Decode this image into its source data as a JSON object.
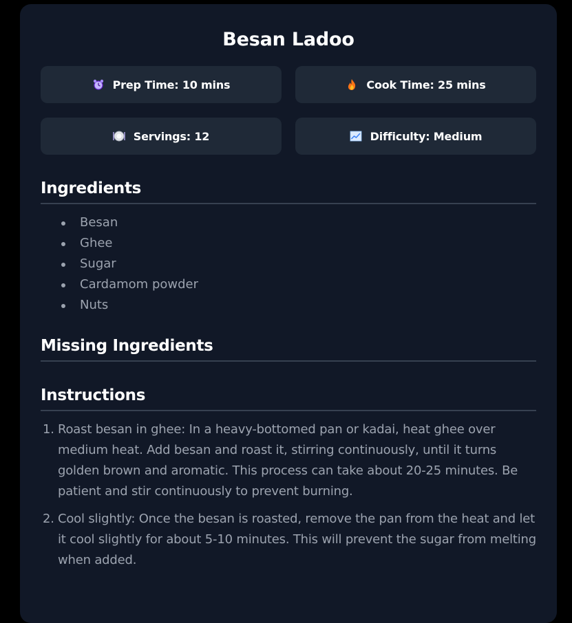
{
  "recipe": {
    "title": "Besan Ladoo",
    "stats": [
      {
        "icon": "alarm-clock-icon",
        "label": "Prep Time: 10 mins"
      },
      {
        "icon": "fire-icon",
        "label": "Cook Time: 25 mins"
      },
      {
        "icon": "plate-icon",
        "label": "Servings: 12"
      },
      {
        "icon": "chart-increasing-icon",
        "label": "Difficulty: Medium"
      }
    ]
  },
  "sections": {
    "ingredients_heading": "Ingredients",
    "missing_heading": "Missing Ingredients",
    "instructions_heading": "Instructions"
  },
  "ingredients": [
    "Besan",
    "Ghee",
    "Sugar",
    "Cardamom powder",
    "Nuts"
  ],
  "instructions": [
    {
      "num": "1.",
      "text": "Roast besan in ghee: In a heavy-bottomed pan or kadai, heat ghee over medium heat. Add besan and roast it, stirring continuously, until it turns golden brown and aromatic. This process can take about 20-25 minutes. Be patient and stir continuously to prevent burning."
    },
    {
      "num": "2.",
      "text": "Cool slightly: Once the besan is roasted, remove the pan from the heat and let it cool slightly for about 5-10 minutes. This will prevent the sugar from melting when added."
    }
  ],
  "colors": {
    "page_bg": "#000000",
    "card_bg": "#111827",
    "stat_bg": "#1f2937",
    "text_primary": "#ffffff",
    "text_muted": "#9ca3af",
    "divider": "#374151"
  }
}
